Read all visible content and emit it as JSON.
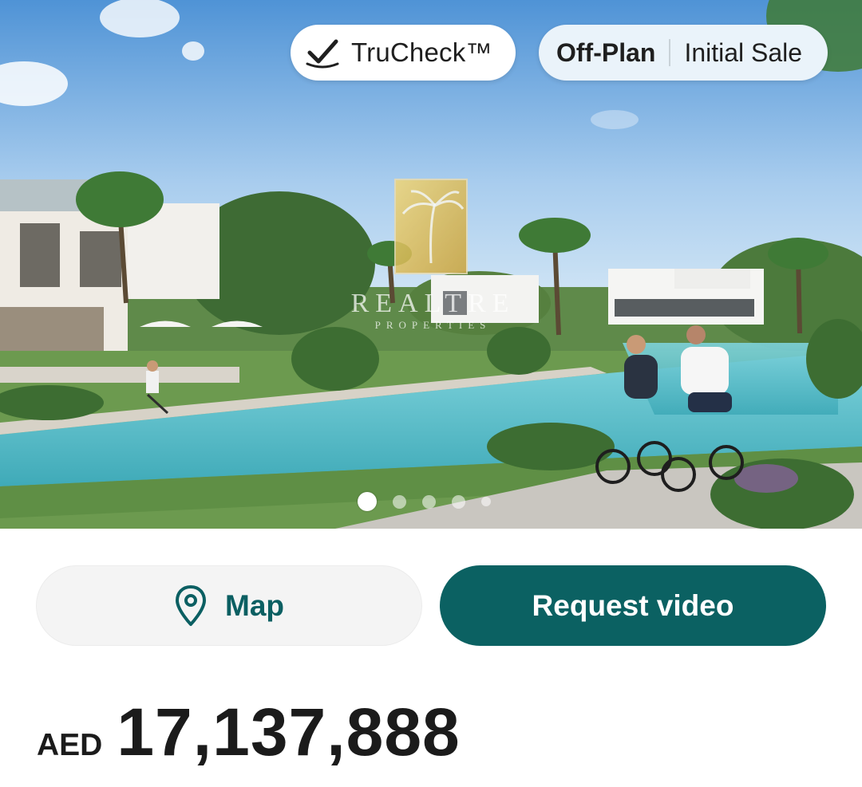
{
  "listing": {
    "badges": {
      "trucheck_label": "TruCheck™",
      "status_primary": "Off-Plan",
      "status_secondary": "Initial Sale"
    },
    "watermark": {
      "line1": "REALTRE",
      "line2": "PROPERTIES"
    },
    "gallery": {
      "total_slides": 5,
      "active_slide": 1
    },
    "actions": {
      "map_label": "Map",
      "request_video_label": "Request video"
    },
    "price": {
      "currency": "AED",
      "amount": "17,137,888"
    }
  },
  "icons": {
    "trucheck": "check-badge-icon",
    "map": "location-pin-icon"
  },
  "colors": {
    "primary": "#0b6162",
    "map_text": "#0b5f62",
    "status_badge_bg": "#eaf3fa"
  }
}
